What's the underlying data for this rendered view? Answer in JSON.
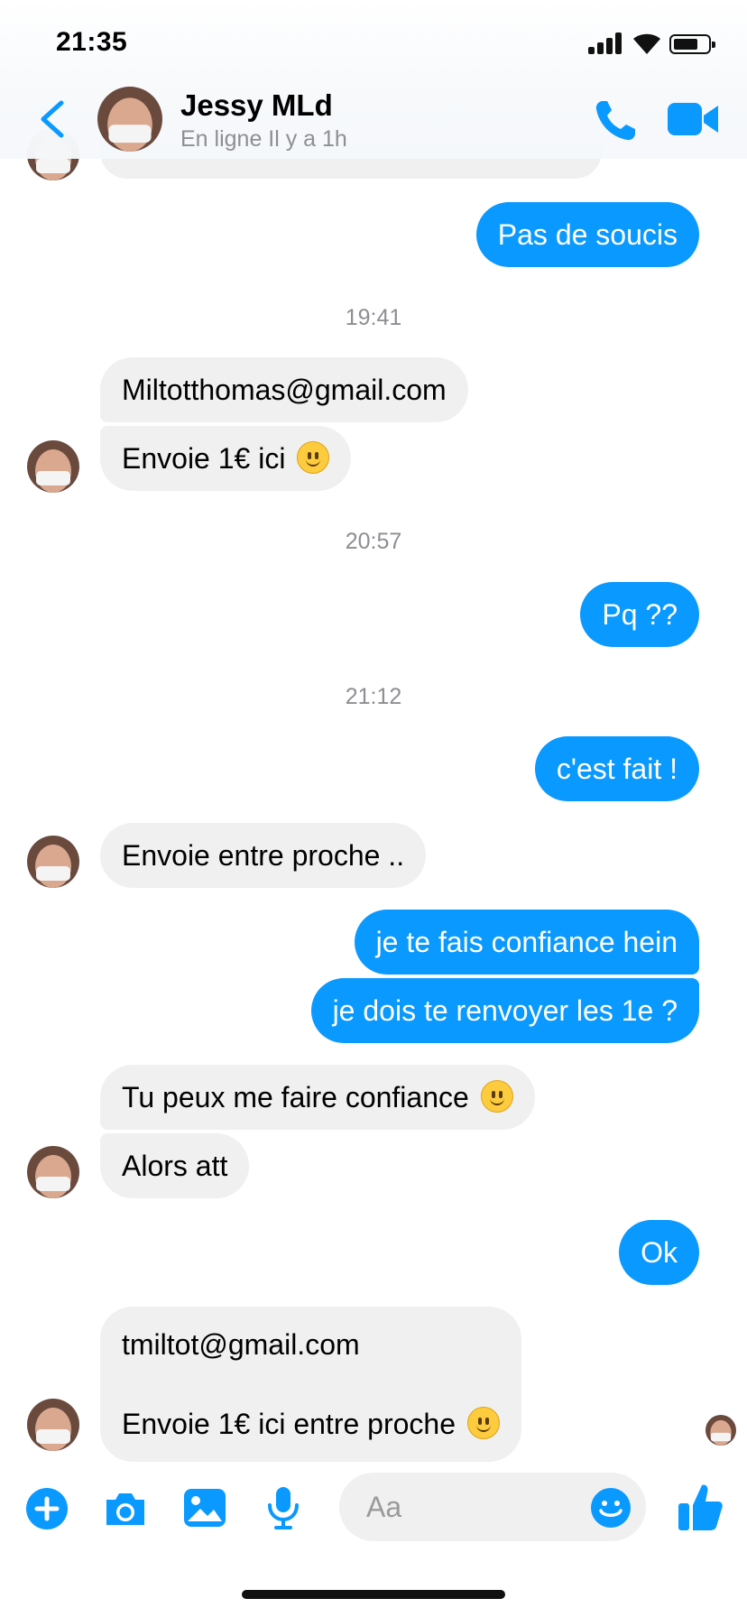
{
  "status_bar": {
    "time": "21:35"
  },
  "header": {
    "contact_name": "Jessy MLd",
    "contact_status": "En ligne Il y a 1h"
  },
  "colors": {
    "accent": "#0a99ff",
    "incoming_bubble": "#f0f0f0",
    "timestamp": "#8e8e93"
  },
  "messages": [
    {
      "type": "outgoing",
      "text": "Pas de soucis"
    },
    {
      "type": "timestamp",
      "text": "19:41"
    },
    {
      "type": "incoming",
      "text": "Miltotthomas@gmail.com"
    },
    {
      "type": "incoming",
      "text": "Envoie 1€ ici",
      "emoji": "slightly-smiling-face"
    },
    {
      "type": "timestamp",
      "text": "20:57"
    },
    {
      "type": "outgoing",
      "text": "Pq ??"
    },
    {
      "type": "timestamp",
      "text": "21:12"
    },
    {
      "type": "outgoing",
      "text": "c'est fait !"
    },
    {
      "type": "incoming",
      "text": "Envoie entre proche .."
    },
    {
      "type": "outgoing",
      "text": "je  te fais confiance hein"
    },
    {
      "type": "outgoing",
      "text": "je dois te renvoyer les 1e ?"
    },
    {
      "type": "incoming",
      "text": "Tu peux me faire confiance",
      "emoji": "slightly-smiling-face"
    },
    {
      "type": "incoming",
      "text": "Alors att"
    },
    {
      "type": "outgoing",
      "text": "Ok"
    },
    {
      "type": "incoming",
      "lines": [
        "tmiltot@gmail.com",
        "",
        "Envoie 1€ ici entre proche"
      ],
      "emoji": "slightly-smiling-face"
    }
  ],
  "composer": {
    "placeholder": "Aa",
    "icons": [
      "plus-icon",
      "camera-icon",
      "image-icon",
      "microphone-icon",
      "emoji-icon",
      "thumbs-up-icon"
    ]
  }
}
